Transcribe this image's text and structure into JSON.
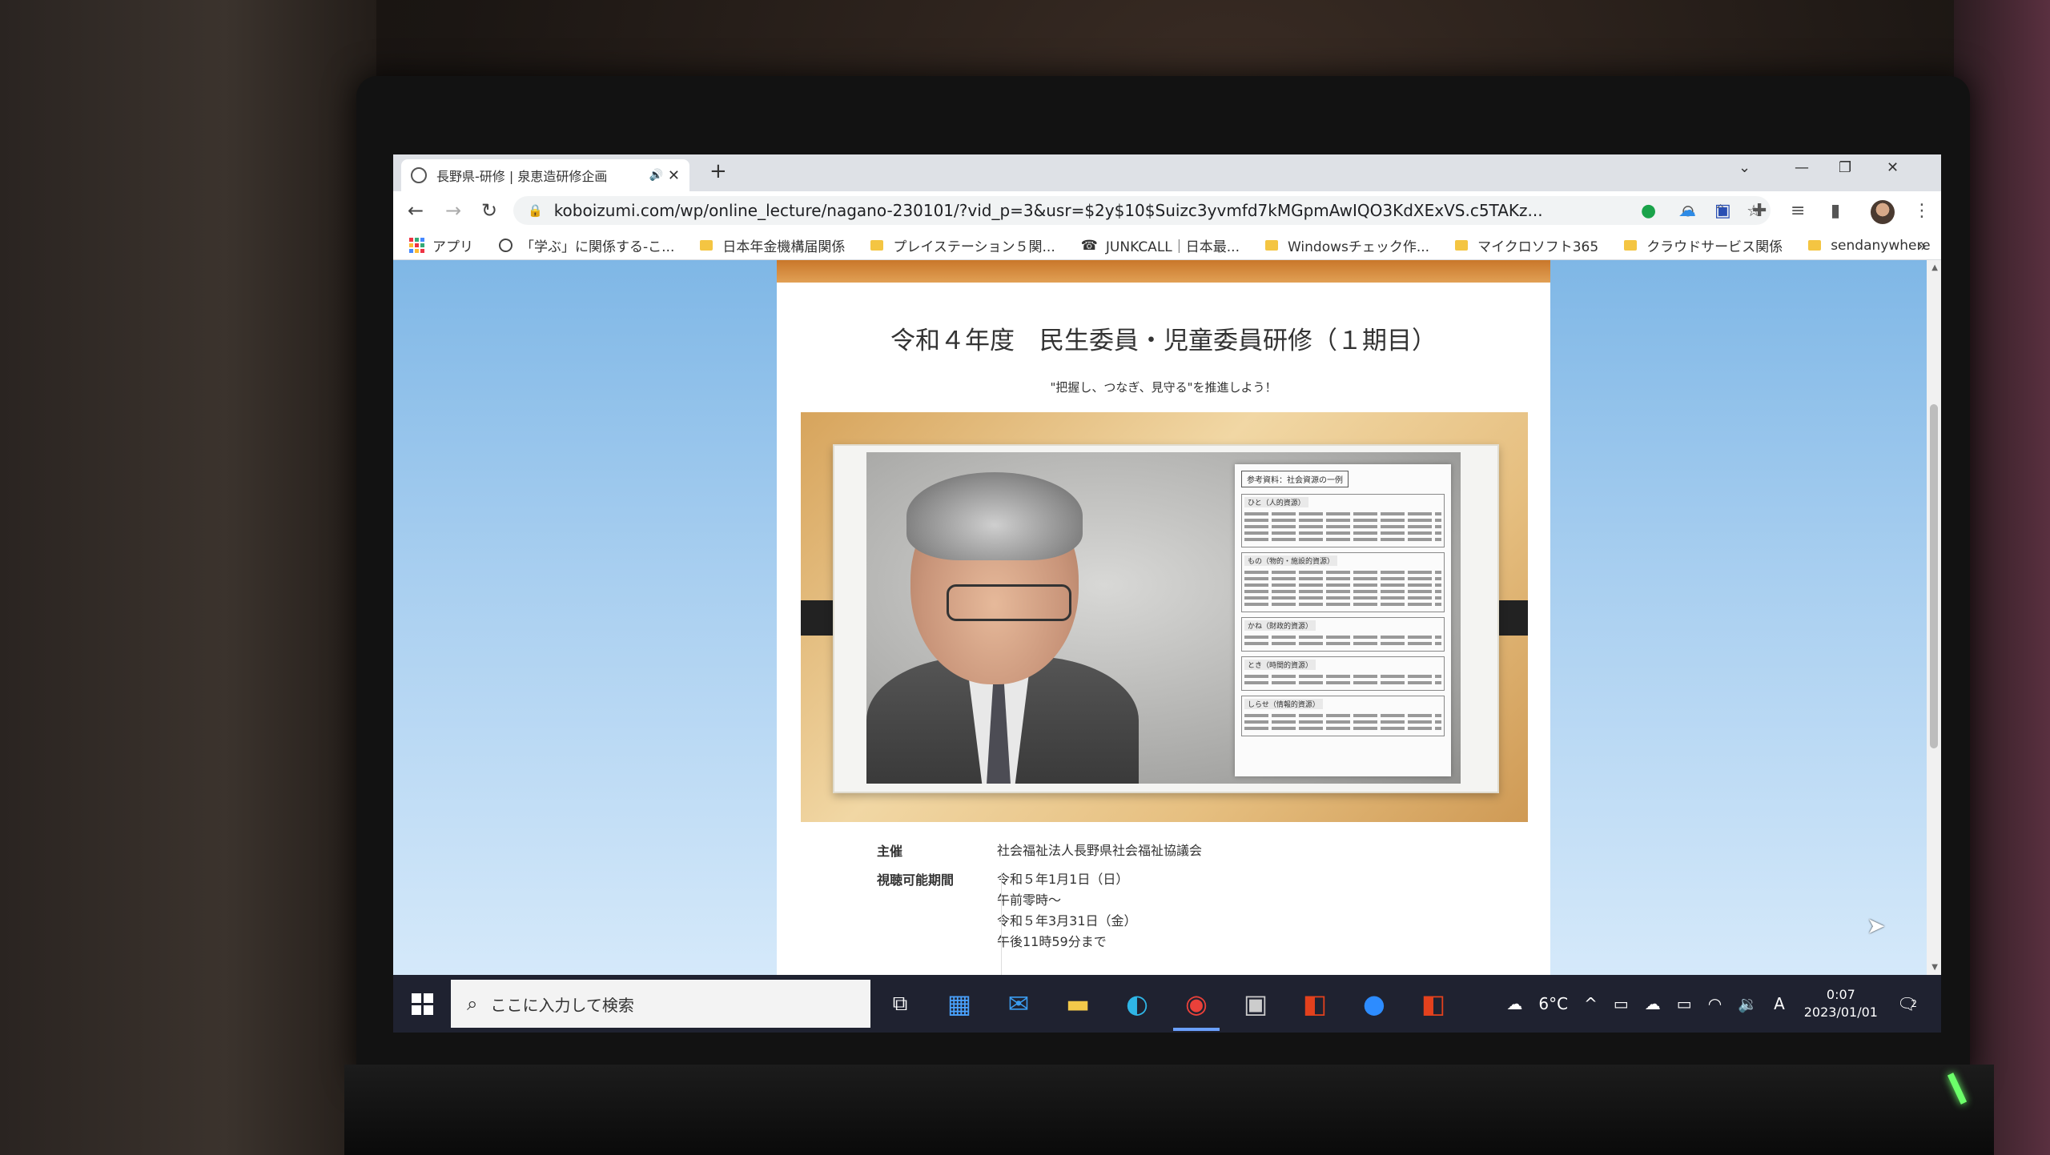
{
  "browser": {
    "tab_title": "長野県-研修 | 泉恵造研修企画",
    "tab_audio_icon": "speaker-icon",
    "url": "koboizumi.com/wp/online_lecture/nagano-230101/?vid_p=3&usr=$2y$10$Suizc3yvmfd7kMGpmAwIQO3KdXExVS.c5TAKz...",
    "bookmarks": [
      {
        "label": "アプリ",
        "icon": "apps-icon"
      },
      {
        "label": "「学ぶ」に関係する-こ...",
        "icon": "globe-icon"
      },
      {
        "label": "日本年金機構届関係",
        "icon": "folder-icon"
      },
      {
        "label": "プレイステーション５関...",
        "icon": "folder-icon"
      },
      {
        "label": "JUNKCALL｜日本最...",
        "icon": "site-icon"
      },
      {
        "label": "Windowsチェック作...",
        "icon": "folder-icon"
      },
      {
        "label": "マイクロソフト365",
        "icon": "folder-icon"
      },
      {
        "label": "クラウドサービス関係",
        "icon": "folder-icon"
      },
      {
        "label": "sendanywhere",
        "icon": "folder-icon"
      }
    ]
  },
  "page": {
    "title": "令和４年度　民生委員・児童委員研修（１期目）",
    "subtitle": "\"把握し、つなぎ、見守る\"を推進しよう！",
    "document": {
      "heading": "参考資料：社会資源の一例",
      "sections": [
        "ひと（人的資源）",
        "もの（物的・施設的資源）",
        "かね（財政的資源）",
        "とき（時間的資源）",
        "しらせ（情報的資源）"
      ]
    },
    "info": [
      {
        "key": "主催",
        "values": [
          "社会福祉法人長野県社会福祉協議会"
        ]
      },
      {
        "key": "視聴可能期間",
        "values": [
          "令和５年1月1日（日）",
          "午前零時～",
          "令和５年3月31日（金）",
          "午後11時59分まで"
        ]
      }
    ]
  },
  "taskbar": {
    "search_placeholder": "ここに入力して検索",
    "weather": "6°C",
    "time": "0:07",
    "date": "2023/01/01",
    "ime": "A",
    "notification_count": "2"
  }
}
